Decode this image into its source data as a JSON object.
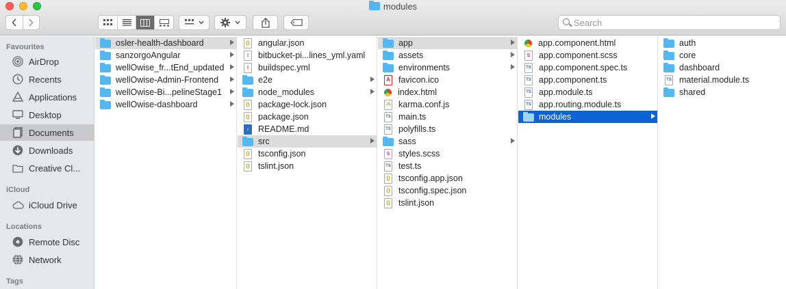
{
  "window": {
    "title": "modules"
  },
  "toolbar": {
    "back_icon": "chevron-left-icon",
    "forward_icon": "chevron-right-icon",
    "view_modes": [
      "icon-view",
      "list-view",
      "column-view",
      "gallery-view"
    ],
    "active_view": "column-view",
    "group_icon": "group-by-icon",
    "action_icon": "gear-icon",
    "share_icon": "share-icon",
    "tag_icon": "tag-icon",
    "search_placeholder": "Search"
  },
  "sidebar": {
    "favourites_heading": "Favourites",
    "favourites": [
      {
        "label": "AirDrop",
        "icon": "airdrop-icon"
      },
      {
        "label": "Recents",
        "icon": "clock-icon"
      },
      {
        "label": "Applications",
        "icon": "applications-icon"
      },
      {
        "label": "Desktop",
        "icon": "desktop-icon"
      },
      {
        "label": "Documents",
        "icon": "document-icon",
        "selected": true
      },
      {
        "label": "Downloads",
        "icon": "download-icon"
      },
      {
        "label": "Creative Cl...",
        "icon": "folder-icon"
      }
    ],
    "icloud_heading": "iCloud",
    "icloud": [
      {
        "label": "iCloud Drive",
        "icon": "cloud-icon"
      }
    ],
    "locations_heading": "Locations",
    "locations": [
      {
        "label": "Remote Disc",
        "icon": "disc-icon"
      },
      {
        "label": "Network",
        "icon": "globe-icon"
      }
    ],
    "tags_heading": "Tags"
  },
  "columns": [
    {
      "items": [
        {
          "name": "osler-health-dashboard",
          "kind": "folder",
          "arrow": true,
          "state": "highlight"
        },
        {
          "name": "sanzorgoAngular",
          "kind": "folder",
          "arrow": true
        },
        {
          "name": "wellOwise_fr...tEnd_updated",
          "kind": "folder",
          "arrow": true
        },
        {
          "name": "wellOwise-Admin-Frontend",
          "kind": "folder",
          "arrow": true
        },
        {
          "name": "wellOwise-Bi...pelineStage1",
          "kind": "folder",
          "arrow": true
        },
        {
          "name": "wellOwise-dashboard",
          "kind": "folder",
          "arrow": true
        }
      ]
    },
    {
      "items": [
        {
          "name": "angular.json",
          "kind": "json"
        },
        {
          "name": "bitbucket-pi...lines_yml.yaml",
          "kind": "yml"
        },
        {
          "name": "buildspec.yml",
          "kind": "yml"
        },
        {
          "name": "e2e",
          "kind": "folder",
          "arrow": true
        },
        {
          "name": "node_modules",
          "kind": "folder",
          "arrow": true
        },
        {
          "name": "package-lock.json",
          "kind": "json"
        },
        {
          "name": "package.json",
          "kind": "json"
        },
        {
          "name": "README.md",
          "kind": "md"
        },
        {
          "name": "src",
          "kind": "folder",
          "arrow": true,
          "state": "highlight"
        },
        {
          "name": "tsconfig.json",
          "kind": "json"
        },
        {
          "name": "tslint.json",
          "kind": "json"
        }
      ]
    },
    {
      "items": [
        {
          "name": "app",
          "kind": "folder",
          "arrow": true,
          "state": "highlight"
        },
        {
          "name": "assets",
          "kind": "folder",
          "arrow": true
        },
        {
          "name": "environments",
          "kind": "folder",
          "arrow": true
        },
        {
          "name": "favicon.ico",
          "kind": "ico"
        },
        {
          "name": "index.html",
          "kind": "html"
        },
        {
          "name": "karma.conf.js",
          "kind": "js"
        },
        {
          "name": "main.ts",
          "kind": "ts"
        },
        {
          "name": "polyfills.ts",
          "kind": "ts"
        },
        {
          "name": "sass",
          "kind": "folder",
          "arrow": true
        },
        {
          "name": "styles.scss",
          "kind": "css"
        },
        {
          "name": "test.ts",
          "kind": "ts"
        },
        {
          "name": "tsconfig.app.json",
          "kind": "json"
        },
        {
          "name": "tsconfig.spec.json",
          "kind": "json"
        },
        {
          "name": "tslint.json",
          "kind": "json"
        }
      ]
    },
    {
      "items": [
        {
          "name": "app.component.html",
          "kind": "html"
        },
        {
          "name": "app.component.scss",
          "kind": "css"
        },
        {
          "name": "app.component.spec.ts",
          "kind": "ts"
        },
        {
          "name": "app.component.ts",
          "kind": "ts"
        },
        {
          "name": "app.module.ts",
          "kind": "ts"
        },
        {
          "name": "app.routing.module.ts",
          "kind": "ts"
        },
        {
          "name": "modules",
          "kind": "folder",
          "arrow": true,
          "state": "active"
        }
      ]
    },
    {
      "items": [
        {
          "name": "auth",
          "kind": "folder"
        },
        {
          "name": "core",
          "kind": "folder"
        },
        {
          "name": "dashboard",
          "kind": "folder"
        },
        {
          "name": "material.module.ts",
          "kind": "ts"
        },
        {
          "name": "shared",
          "kind": "folder"
        }
      ]
    }
  ]
}
